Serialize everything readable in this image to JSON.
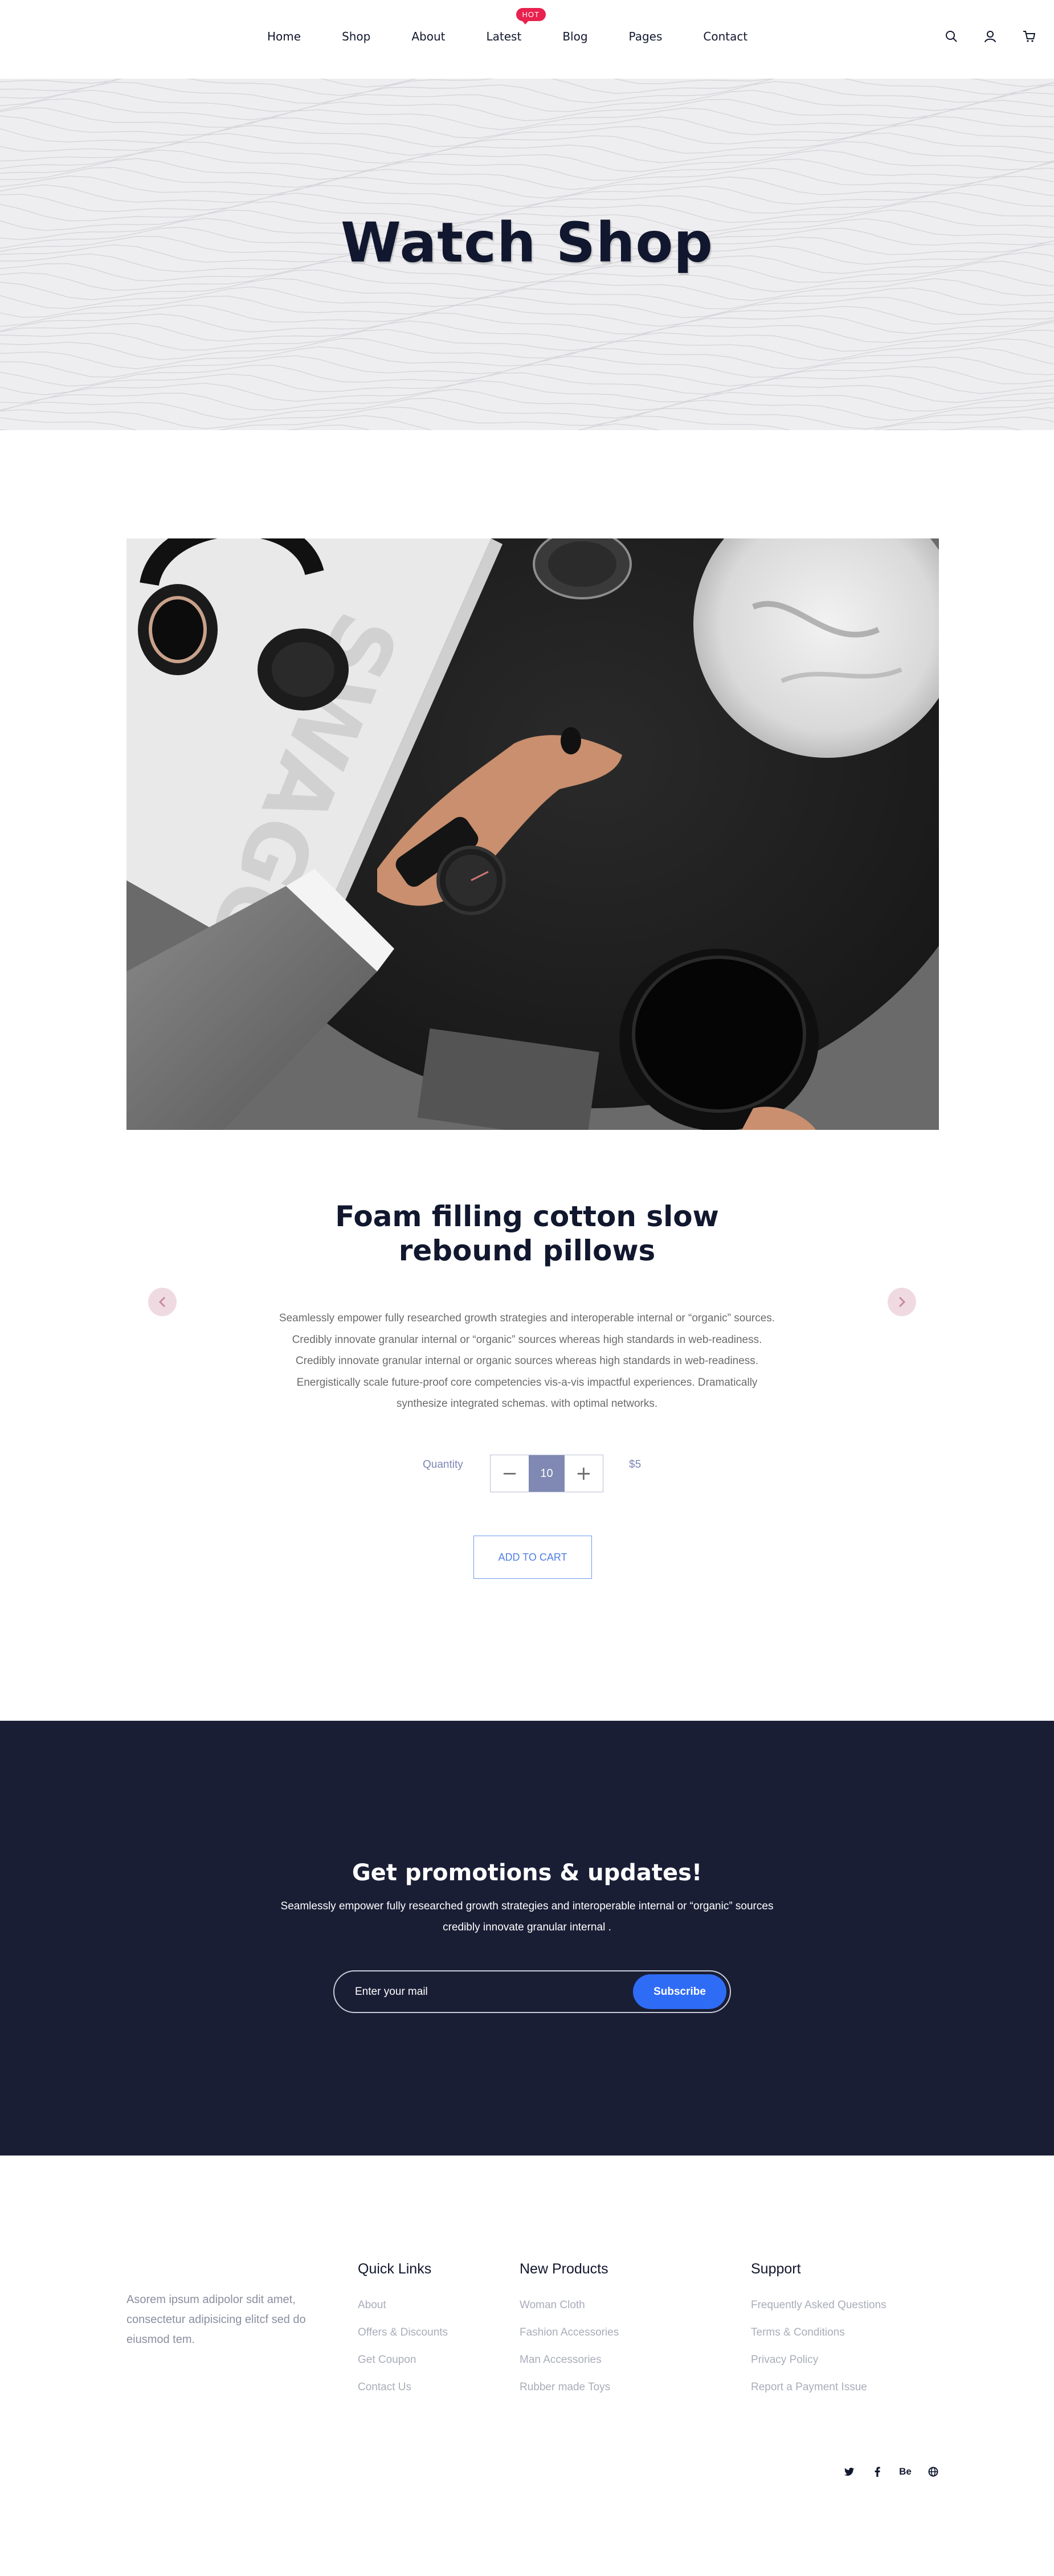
{
  "header": {
    "nav": [
      {
        "label": "Home"
      },
      {
        "label": "Shop"
      },
      {
        "label": "About"
      },
      {
        "label": "Latest"
      },
      {
        "label": "Blog"
      },
      {
        "label": "Pages"
      },
      {
        "label": "Contact"
      }
    ],
    "hot_badge": "HOT",
    "icons": [
      "search-icon",
      "user-icon",
      "cart-icon"
    ]
  },
  "hero": {
    "title": "Watch Shop"
  },
  "product": {
    "title_line1": "Foam filling cotton slow",
    "title_line2": "rebound pillows",
    "description": [
      "Seamlessly empower fully researched growth strategies and interoperable internal or “organic” sources.",
      "Credibly innovate granular internal or “organic” sources whereas high standards in web-readiness.",
      "Credibly innovate granular internal or organic sources whereas high standards in web-readiness.",
      "Energistically scale future-proof core competencies vis-a-vis impactful experiences. Dramatically",
      "synthesize integrated schemas. with optimal networks."
    ],
    "quantity_label": "Quantity",
    "decrement": "−",
    "quantity_value": "10",
    "increment": "+",
    "price": "$5",
    "add_to_cart": "ADD TO CART",
    "image_text": "SWAGGER"
  },
  "newsletter": {
    "title": "Get promotions & updates!",
    "text_line1": "Seamlessly empower fully researched growth strategies and interoperable internal or “organic” sources",
    "text_line2": "credibly innovate granular internal .",
    "placeholder": "Enter your mail",
    "button": "Subscribe"
  },
  "footer": {
    "about": "Asorem ipsum adipolor sdit amet, consectetur adipisicing elitcf sed do eiusmod tem.",
    "quick_links": {
      "title": "Quick Links",
      "items": [
        "About",
        "Offers & Discounts",
        "Get Coupon",
        "Contact Us"
      ]
    },
    "new_products": {
      "title": "New Products",
      "items": [
        "Woman Cloth",
        "Fashion Accessories",
        "Man Accessories",
        "Rubber made Toys"
      ]
    },
    "support": {
      "title": "Support",
      "items": [
        "Frequently Asked Questions",
        "Terms & Conditions",
        "Privacy Policy",
        "Report a Payment Issue"
      ]
    },
    "social": [
      "twitter-icon",
      "facebook-icon",
      "behance-icon",
      "globe-icon"
    ],
    "behance_label": "Be"
  },
  "colors": {
    "navy": "#10172e",
    "newsletter_bg": "#1a1e35",
    "accent_blue": "#2f6cf6",
    "hot_red": "#e8214e",
    "stepper_value_bg": "#7f89b3"
  }
}
